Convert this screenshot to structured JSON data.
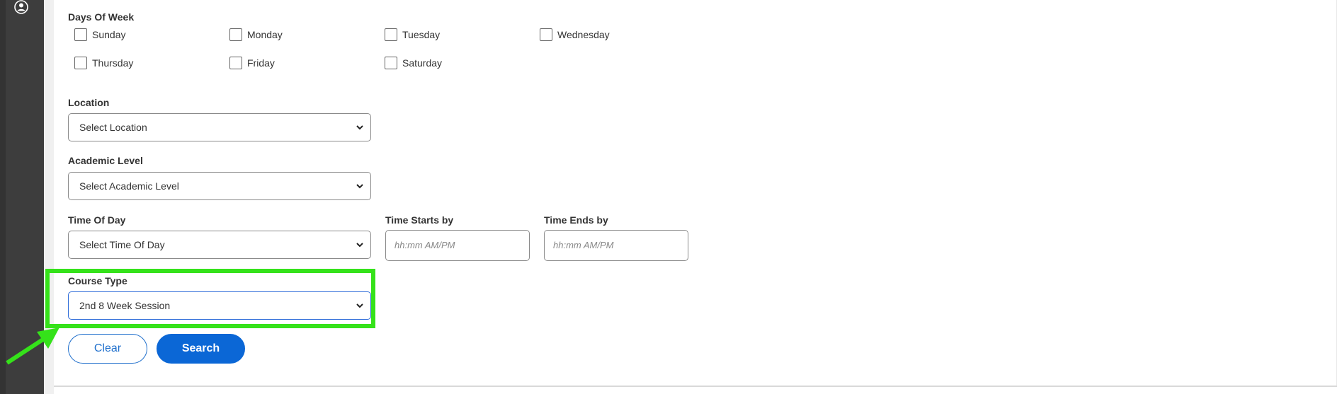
{
  "days_of_week": {
    "label": "Days Of Week",
    "days": [
      "Sunday",
      "Monday",
      "Tuesday",
      "Wednesday",
      "Thursday",
      "Friday",
      "Saturday"
    ]
  },
  "location": {
    "label": "Location",
    "value": "Select Location"
  },
  "academic_level": {
    "label": "Academic Level",
    "value": "Select Academic Level"
  },
  "time_of_day": {
    "label": "Time Of Day",
    "value": "Select Time Of Day"
  },
  "time_starts_by": {
    "label": "Time Starts by",
    "placeholder": "hh:mm AM/PM"
  },
  "time_ends_by": {
    "label": "Time Ends by",
    "placeholder": "hh:mm AM/PM"
  },
  "course_type": {
    "label": "Course Type",
    "value": "2nd 8 Week Session"
  },
  "buttons": {
    "clear": "Clear",
    "search": "Search"
  },
  "colors": {
    "highlight": "#35e21a",
    "primary": "#0b67d6",
    "rail": "#3d3d3d"
  },
  "icons": {
    "user": "user-icon",
    "chevron": "chevron-down-icon",
    "arrow": "arrow-annotation"
  }
}
